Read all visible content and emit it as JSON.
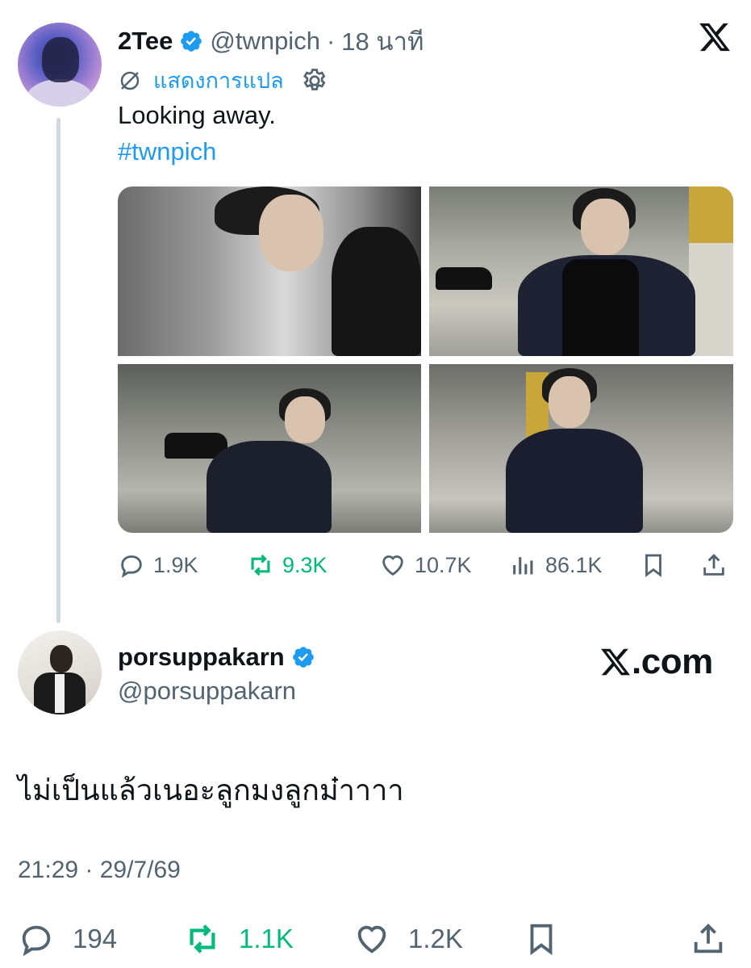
{
  "tweet": {
    "author_name": "2Tee",
    "handle": "@twnpich",
    "time": "18 นาที",
    "translate_label": "แสดงการแปล",
    "text": "Looking away.",
    "hashtag": "#twnpich",
    "stats": {
      "replies": "1.9K",
      "retweets": "9.3K",
      "likes": "10.7K",
      "views": "86.1K"
    }
  },
  "reply": {
    "author_name": "porsuppakarn",
    "handle": "@porsuppakarn",
    "text": "ไม่เป็นแล้วเนอะลูกมงลูกม๋าาาา",
    "timestamp": "21:29 · 29/7/69",
    "stats": {
      "replies": "194",
      "retweets": "1.1K",
      "likes": "1.2K"
    }
  },
  "branding": {
    "xcom_label": ".com",
    "accent_color": "#1d9bf0",
    "retweet_color": "#00ba7c"
  },
  "icons": [
    "x-logo-icon",
    "verified-icon",
    "translate-icon",
    "gear-icon",
    "reply-icon",
    "retweet-icon",
    "like-icon",
    "views-icon",
    "bookmark-icon",
    "share-icon"
  ]
}
